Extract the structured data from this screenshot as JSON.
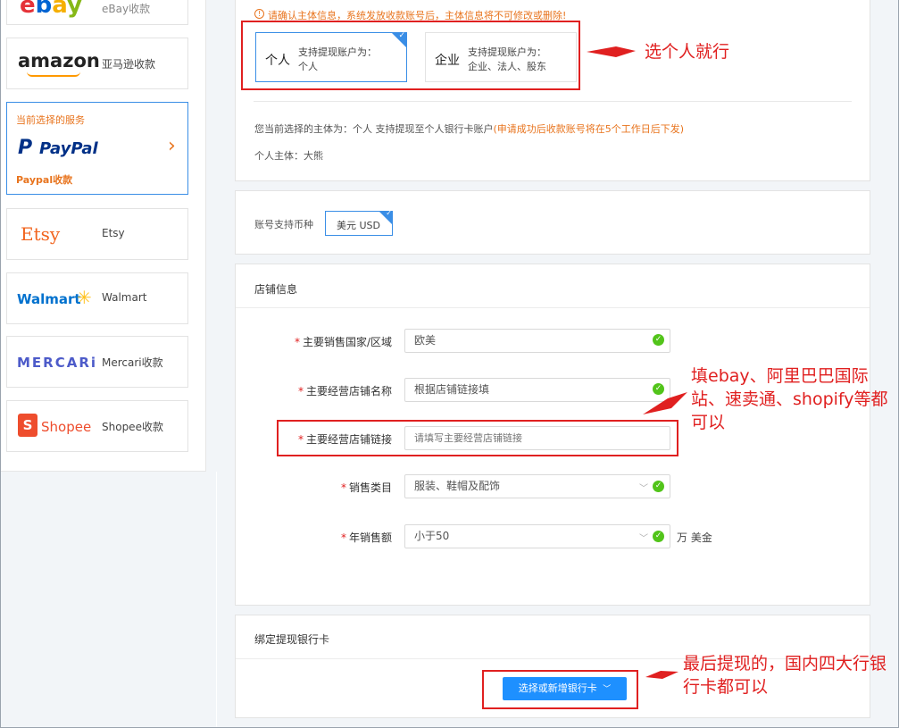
{
  "sidebar": {
    "items": [
      {
        "logo": "ebay",
        "label": "eBay收款"
      },
      {
        "logo": "amazon",
        "label": "亚马逊收款"
      },
      {
        "logo": "PayPal",
        "label": "Paypal收款",
        "caption": "当前选择的服务"
      },
      {
        "logo": "Etsy",
        "label": "Etsy"
      },
      {
        "logo": "Walmart",
        "label": "Walmart"
      },
      {
        "logo": "MERCARi",
        "label": "Mercari收款"
      },
      {
        "logo": "Shopee",
        "label": "Shopee收款"
      }
    ]
  },
  "entity": {
    "warning": "请确认主体信息，系统发放收款账号后，主体信息将不可修改或删除!",
    "options": [
      {
        "title": "个人",
        "line1": "支持提现账户为：",
        "line2": "个人",
        "selected": true
      },
      {
        "title": "企业",
        "line1": "支持提现账户为：",
        "line2": "企业、法人、股东",
        "selected": false
      }
    ],
    "summary_prefix": "您当前选择的主体为：个人 支持提现至个人银行卡账户",
    "summary_note": "(申请成功后收款账号将在5个工作日后下发)",
    "subject": "个人主体：大熊"
  },
  "currency": {
    "label": "账号支持币种",
    "value": "美元 USD"
  },
  "store": {
    "title": "店铺信息",
    "fields": [
      {
        "label": "主要销售国家/区域",
        "value": "欧美"
      },
      {
        "label": "主要经营店铺名称",
        "value": "根据店铺链接填"
      },
      {
        "label": "主要经营店铺链接",
        "placeholder": "请填写主要经营店铺链接"
      },
      {
        "label": "销售类目",
        "value": "服装、鞋帽及配饰"
      },
      {
        "label": "年销售额",
        "value": "小于50",
        "unit": "万 美金"
      }
    ]
  },
  "bank": {
    "title": "绑定提现银行卡",
    "button": "选择或新增银行卡"
  },
  "notes": {
    "n1": "选个人就行",
    "n2": "填ebay、阿里巴巴国际站、速卖通、shopify等都可以",
    "n3": "最后提现的，国内四大行银行卡都可以"
  },
  "colors": {
    "accent": "#1e90ff",
    "annotation": "#e02020",
    "paypal_orange": "#e8741e"
  }
}
